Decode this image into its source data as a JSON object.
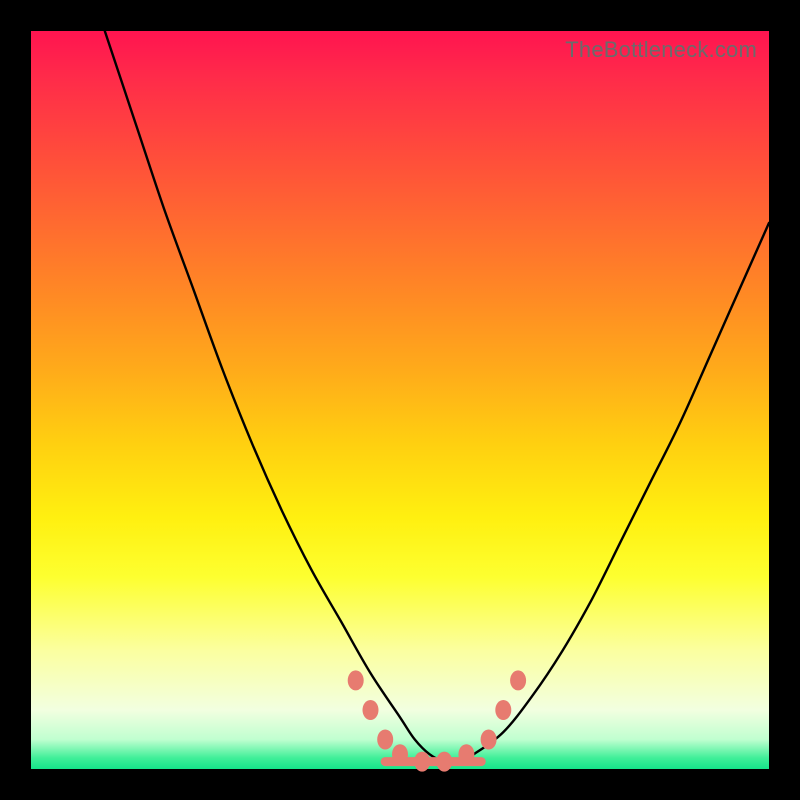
{
  "watermark": "TheBottleneck.com",
  "chart_data": {
    "type": "line",
    "title": "",
    "xlabel": "",
    "ylabel": "",
    "xlim": [
      0,
      100
    ],
    "ylim": [
      0,
      100
    ],
    "grid": false,
    "legend": false,
    "background_gradient": {
      "direction": "vertical",
      "stops": [
        {
          "pos": 0,
          "color": "#ff1450"
        },
        {
          "pos": 50,
          "color": "#ffc010"
        },
        {
          "pos": 80,
          "color": "#fdff60"
        },
        {
          "pos": 100,
          "color": "#15e58a"
        }
      ]
    },
    "series": [
      {
        "name": "bottleneck-curve",
        "color": "#000000",
        "x": [
          10,
          14,
          18,
          22,
          26,
          30,
          34,
          38,
          42,
          46,
          50,
          52,
          54,
          56,
          58,
          60,
          64,
          68,
          72,
          76,
          80,
          84,
          88,
          92,
          96,
          100
        ],
        "y": [
          100,
          88,
          76,
          65,
          54,
          44,
          35,
          27,
          20,
          13,
          7,
          4,
          2,
          1,
          1,
          2,
          5,
          10,
          16,
          23,
          31,
          39,
          47,
          56,
          65,
          74
        ]
      }
    ],
    "markers": {
      "name": "highlight-dots",
      "color": "#e77b70",
      "points": [
        {
          "x": 44,
          "y": 12
        },
        {
          "x": 46,
          "y": 8
        },
        {
          "x": 48,
          "y": 4
        },
        {
          "x": 50,
          "y": 2
        },
        {
          "x": 53,
          "y": 1
        },
        {
          "x": 56,
          "y": 1
        },
        {
          "x": 59,
          "y": 2
        },
        {
          "x": 62,
          "y": 4
        },
        {
          "x": 64,
          "y": 8
        },
        {
          "x": 66,
          "y": 12
        }
      ]
    },
    "flat_bottom_segment": {
      "color": "#e77b70",
      "x_start": 48,
      "x_end": 61,
      "y": 1
    }
  }
}
